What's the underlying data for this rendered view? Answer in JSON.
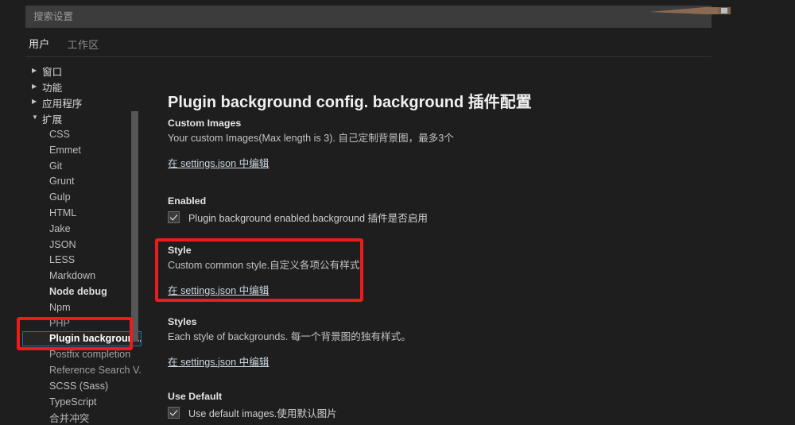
{
  "window": {
    "background_color": "#1e1e1e",
    "accent_color": "#ec1c1c",
    "selection_outline_color": "#2d6ca8"
  },
  "search": {
    "placeholder": "搜索设置",
    "value": ""
  },
  "tabs": [
    {
      "label": "用户",
      "active": true
    },
    {
      "label": "工作区",
      "active": false
    }
  ],
  "sidebar": {
    "groups": [
      {
        "label": "窗口",
        "twisty": "collapsed-icon"
      },
      {
        "label": "功能",
        "twisty": "collapsed-icon"
      },
      {
        "label": "应用程序",
        "twisty": "collapsed-icon"
      },
      {
        "label": "扩展",
        "twisty": "expanded-icon"
      }
    ],
    "items": [
      {
        "label": "CSS"
      },
      {
        "label": "Emmet"
      },
      {
        "label": "Git"
      },
      {
        "label": "Grunt"
      },
      {
        "label": "Gulp"
      },
      {
        "label": "HTML"
      },
      {
        "label": "Jake"
      },
      {
        "label": "JSON"
      },
      {
        "label": "LESS"
      },
      {
        "label": "Markdown"
      },
      {
        "label": "Node debug"
      },
      {
        "label": "Npm"
      },
      {
        "label": "PHP"
      },
      {
        "label": "Plugin backgroun..."
      },
      {
        "label": "Postfix completion"
      },
      {
        "label": "Reference Search V..."
      },
      {
        "label": "SCSS (Sass)"
      },
      {
        "label": "TypeScript"
      },
      {
        "label": "合并冲突"
      }
    ]
  },
  "content": {
    "title": "Plugin background config. background 插件配置",
    "link_label": "在 settings.json 中编辑",
    "settings": [
      {
        "key": "custom-images",
        "title": "Custom Images",
        "description": "Your custom Images(Max length is 3). 自己定制背景图，最多3个",
        "link": "在 settings.json 中编辑"
      },
      {
        "key": "enabled",
        "title": "Enabled",
        "checkbox_label": "Plugin background enabled.background 插件是否启用",
        "checked": true
      },
      {
        "key": "style",
        "title": "Style",
        "description": "Custom common style.自定义各项公有样式.",
        "link": "在 settings.json 中编辑",
        "highlighted": true
      },
      {
        "key": "styles",
        "title": "Styles",
        "description": "Each style of backgrounds. 每一个背景图的独有样式。",
        "link": "在 settings.json 中编辑"
      },
      {
        "key": "use-default",
        "title": "Use Default",
        "checkbox_label": "Use default images.使用默认图片",
        "checked": true
      }
    ]
  }
}
